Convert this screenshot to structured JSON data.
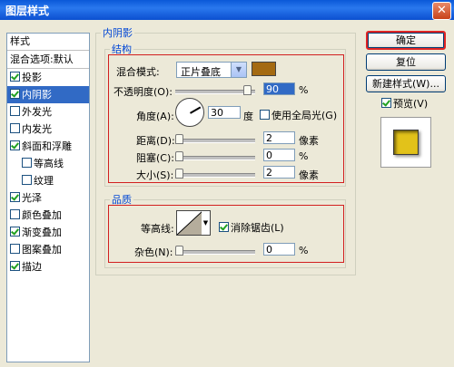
{
  "window": {
    "title": "图层样式",
    "close_glyph": "✕"
  },
  "styles_list": {
    "header": "样式",
    "blend_options": "混合选项:默认",
    "items": [
      {
        "label": "投影",
        "checked": true,
        "selected": false,
        "indent": false
      },
      {
        "label": "内阴影",
        "checked": true,
        "selected": true,
        "indent": false
      },
      {
        "label": "外发光",
        "checked": false,
        "selected": false,
        "indent": false
      },
      {
        "label": "内发光",
        "checked": false,
        "selected": false,
        "indent": false
      },
      {
        "label": "斜面和浮雕",
        "checked": true,
        "selected": false,
        "indent": false
      },
      {
        "label": "等高线",
        "checked": false,
        "selected": false,
        "indent": true
      },
      {
        "label": "纹理",
        "checked": false,
        "selected": false,
        "indent": true
      },
      {
        "label": "光泽",
        "checked": true,
        "selected": false,
        "indent": false
      },
      {
        "label": "颜色叠加",
        "checked": false,
        "selected": false,
        "indent": false
      },
      {
        "label": "渐变叠加",
        "checked": true,
        "selected": false,
        "indent": false
      },
      {
        "label": "图案叠加",
        "checked": false,
        "selected": false,
        "indent": false
      },
      {
        "label": "描边",
        "checked": true,
        "selected": false,
        "indent": false
      }
    ]
  },
  "panel": {
    "title": "内阴影",
    "structure": {
      "title": "结构",
      "blend_mode_label": "混合模式:",
      "blend_mode_value": "正片叠底",
      "swatch_color": "#a46a12",
      "opacity_label": "不透明度(O):",
      "opacity_value": "90",
      "opacity_unit": "%",
      "opacity_fraction": 0.9,
      "angle_label": "角度(A):",
      "angle_value": "30",
      "angle_unit": "度",
      "global_light_label": "使用全局光(G)",
      "global_light_checked": false,
      "distance_label": "距离(D):",
      "distance_value": "2",
      "distance_unit": "像素",
      "choke_label": "阻塞(C):",
      "choke_value": "0",
      "choke_unit": "%",
      "size_label": "大小(S):",
      "size_value": "2",
      "size_unit": "像素"
    },
    "quality": {
      "title": "品质",
      "contour_label": "等高线:",
      "antialias_label": "消除锯齿(L)",
      "antialias_checked": true,
      "noise_label": "杂色(N):",
      "noise_value": "0",
      "noise_unit": "%"
    }
  },
  "buttons": {
    "ok": "确定",
    "reset": "复位",
    "new_style": "新建样式(W)...",
    "preview_label": "预览(V)",
    "preview_checked": true
  },
  "colors": {
    "selection": "#316ac5",
    "accent_red": "#d21f1f",
    "preview_gold": "#e2c21a"
  }
}
